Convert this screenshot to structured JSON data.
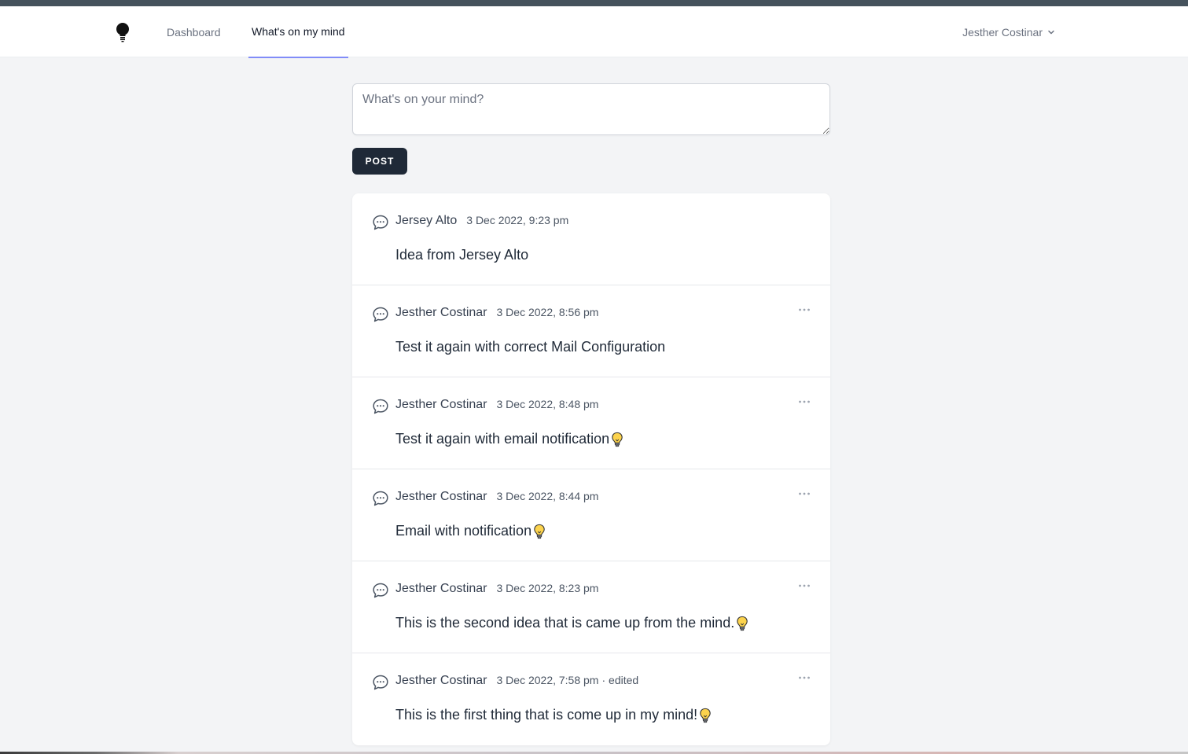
{
  "nav": {
    "logo_icon": "lightbulb-icon",
    "links": [
      {
        "label": "Dashboard"
      },
      {
        "label": "What's on my mind"
      }
    ],
    "user_name": "Jesther Costinar",
    "user_menu_icon": "chevron-down-icon"
  },
  "composer": {
    "placeholder": "What's on your mind?",
    "value": ""
  },
  "post_button_label": "POST",
  "posts": [
    {
      "author": "Jersey Alto",
      "time": "3 Dec 2022, 9:23 pm",
      "edited": "",
      "text": "Idea from Jersey Alto",
      "has_bulb": false,
      "has_menu": false
    },
    {
      "author": "Jesther Costinar",
      "time": "3 Dec 2022, 8:56 pm",
      "edited": "",
      "text": "Test it again with correct Mail Configuration",
      "has_bulb": false,
      "has_menu": true
    },
    {
      "author": "Jesther Costinar",
      "time": "3 Dec 2022, 8:48 pm",
      "edited": "",
      "text": "Test it again with email notification",
      "has_bulb": true,
      "has_menu": true
    },
    {
      "author": "Jesther Costinar",
      "time": "3 Dec 2022, 8:44 pm",
      "edited": "",
      "text": "Email with notification",
      "has_bulb": true,
      "has_menu": true
    },
    {
      "author": "Jesther Costinar",
      "time": "3 Dec 2022, 8:23 pm",
      "edited": "",
      "text": "This is the second idea that is came up from the mind.",
      "has_bulb": true,
      "has_menu": true
    },
    {
      "author": "Jesther Costinar",
      "time": "3 Dec 2022, 7:58 pm",
      "edited": "· edited",
      "text": "This is the first thing that is come up in my mind! ",
      "has_bulb": true,
      "has_menu": true
    }
  ],
  "colors": {
    "accent": "#818cf8",
    "button": "#1f2937",
    "background": "#f3f4f6",
    "bulb": "#fcd34d"
  }
}
